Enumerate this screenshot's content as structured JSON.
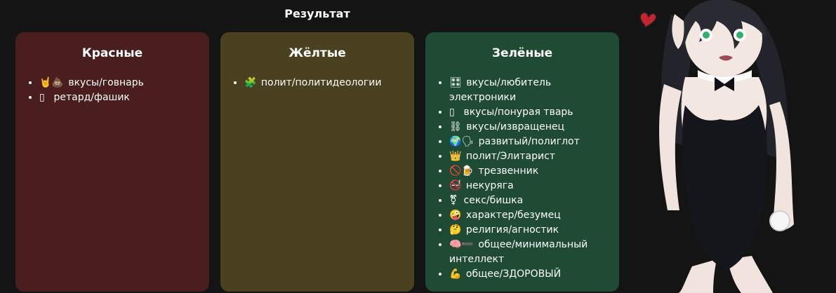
{
  "header": {
    "title": "Результат"
  },
  "columns": [
    {
      "key": "red",
      "title": "Красные",
      "items": [
        {
          "emoji": "🤘💩",
          "text": "вкусы/говнарь"
        },
        {
          "emoji": "▯",
          "text": "ретард/фашик"
        }
      ]
    },
    {
      "key": "yellow",
      "title": "Жёлтые",
      "items": [
        {
          "emoji": "🧩",
          "text": "полит/политидеологии"
        }
      ]
    },
    {
      "key": "green",
      "title": "Зелёные",
      "items": [
        {
          "emoji": "🎛",
          "text": "вкусы/любитель электроники"
        },
        {
          "emoji": "▯",
          "text": "вкусы/понурая тварь"
        },
        {
          "emoji": "⛓",
          "text": "вкусы/извращенец"
        },
        {
          "emoji": "🌍🗣",
          "text": "развитый/полиглот"
        },
        {
          "emoji": "👑",
          "text": "полит/Элитарист"
        },
        {
          "emoji": "🚫🍺",
          "text": "трезвенник"
        },
        {
          "emoji": "🚭",
          "text": "некуряга"
        },
        {
          "emoji": "⚧",
          "text": "секс/бишка"
        },
        {
          "emoji": "🤪",
          "text": "характер/безумец"
        },
        {
          "emoji": "🤔",
          "text": "религия/агностик"
        },
        {
          "emoji": "🧠➖",
          "text": "общее/минимальный интеллект"
        },
        {
          "emoji": "💪",
          "text": "общее/ЗДОРОВЫЙ"
        }
      ]
    }
  ],
  "colors": {
    "background": "#141414",
    "red_card": "#4a1e1e",
    "yellow_card": "#4a4120",
    "green_card": "#1f4a34"
  },
  "icons": {
    "illustration": "anime-character-illustration",
    "heart": "heart-icon"
  }
}
